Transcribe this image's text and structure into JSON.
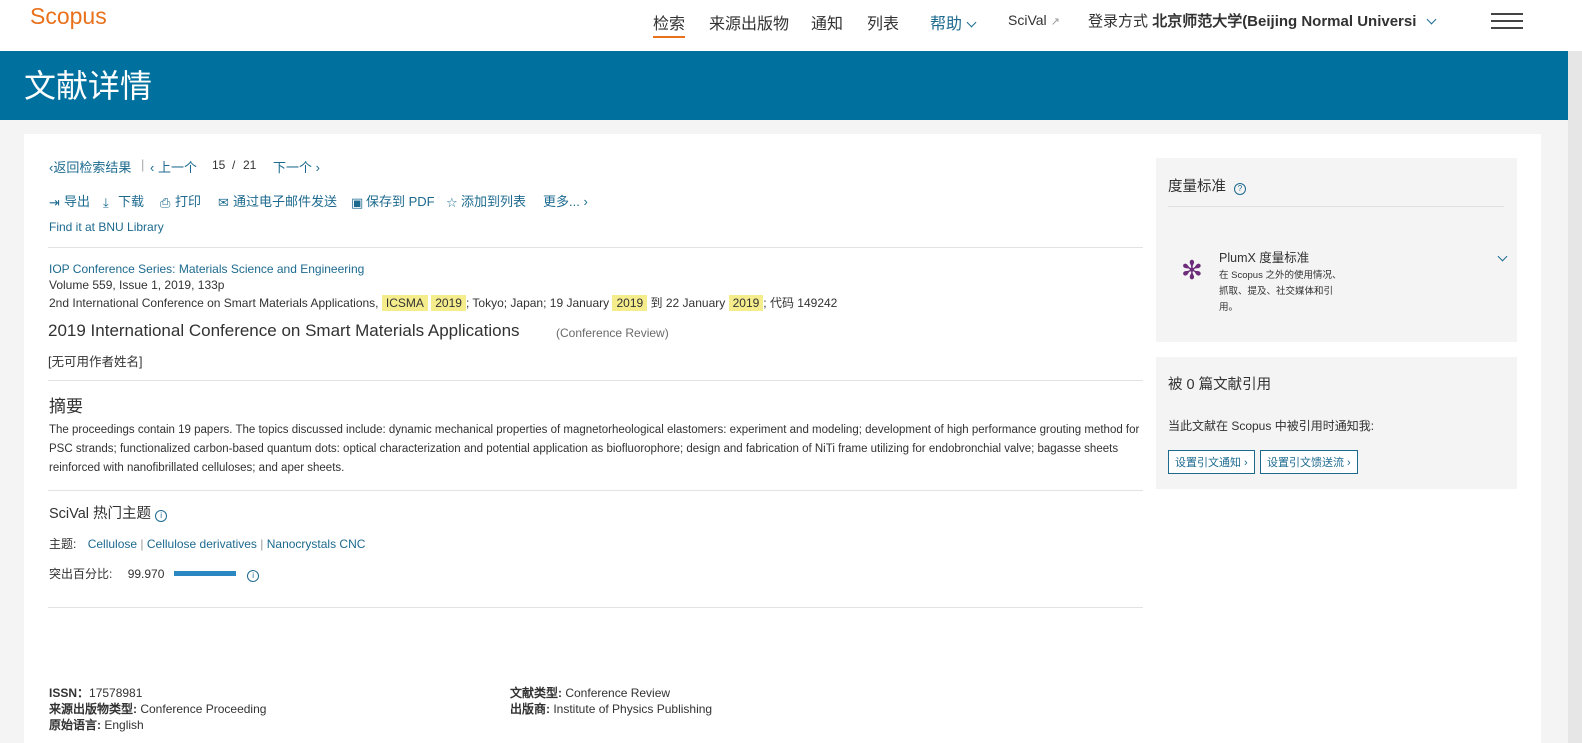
{
  "header": {
    "logo": "Scopus",
    "nav": [
      "检索",
      "来源出版物",
      "通知",
      "列表"
    ],
    "help": "帮助",
    "scival": "SciVal",
    "login_prefix": "登录方式",
    "institution": "北京师范大学(Beijing Normal Universi"
  },
  "banner": {
    "title": "文献详情"
  },
  "breadcrumb": {
    "back": "返回检索结果",
    "prev": "上一个",
    "position": "15",
    "sep": "/",
    "total": "21",
    "next": "下一个"
  },
  "toolbar": {
    "export": "导出",
    "download": "下载",
    "print": "打印",
    "email": "通过电子邮件发送",
    "pdf": "保存到 PDF",
    "add_list": "添加到列表",
    "more": "更多..."
  },
  "library_link": "Find it at BNU Library",
  "source": {
    "journal": "IOP Conference Series: Materials Science and Engineering",
    "volume": "Volume 559, Issue 1, 2019, 133p",
    "conf_prefix": "2nd International Conference on Smart Materials Applications,",
    "conf_abbr": "ICSMA",
    "conf_year": "2019",
    "conf_loc": "; Tokyo; Japan; 19 January",
    "date_year1": "2019",
    "conf_to": "到 22 January",
    "date_year2": "2019",
    "conf_code": "; 代码 149242"
  },
  "doc": {
    "title": "2019 International Conference on Smart Materials Applications",
    "type_label": "(Conference Review)",
    "authors": "[无可用作者姓名]"
  },
  "abstract": {
    "heading": "摘要",
    "text": "The proceedings contain 19 papers. The topics discussed include: dynamic mechanical properties of magnetorheological elastomers: experiment and modeling; development of high performance grouting method for PSC strands; functionalized carbon-based quantum dots: optical characterization and potential application as biofluorophore; design and fabrication of NiTi frame utilizing for endobronchial valve; bagasse sheets reinforced with nanofibrillated celluloses; and aper sheets."
  },
  "scival_topic": {
    "heading": "SciVal 热门主题",
    "topic_label": "主题:",
    "topics": [
      "Cellulose",
      "Cellulose derivatives",
      "Nanocrystals CNC"
    ],
    "topic_sep": "|",
    "percentile_label": "突出百分比:",
    "percentile": "99.970",
    "percentile_fill": 0.9997
  },
  "details": {
    "issn_label": "ISSN：",
    "issn": "17578981",
    "source_type_label": "来源出版物类型:",
    "source_type": "Conference Proceeding",
    "lang_label": "原始语言:",
    "lang": "English",
    "doctype_label": "文献类型:",
    "doctype": "Conference Review",
    "publisher_label": "出版商:",
    "publisher": "Institute of Physics Publishing"
  },
  "metrics": {
    "heading": "度量标准",
    "plumx_title": "PlumX 度量标准",
    "plumx_desc1": "在 Scopus 之外的使用情况、",
    "plumx_desc2": "抓取、提及、社交媒体和引",
    "plumx_desc3": "用。"
  },
  "citations": {
    "heading": "被 0 篇文献引用",
    "notify": "当此文献在 Scopus 中被引用时通知我:",
    "alert_btn": "设置引文通知",
    "feed_btn": "设置引文馈送流"
  },
  "colors": {
    "brand_orange": "#e9711c",
    "banner_blue": "#00719e",
    "link_blue": "#1d6a8f",
    "highlight": "#f5ec8c"
  }
}
